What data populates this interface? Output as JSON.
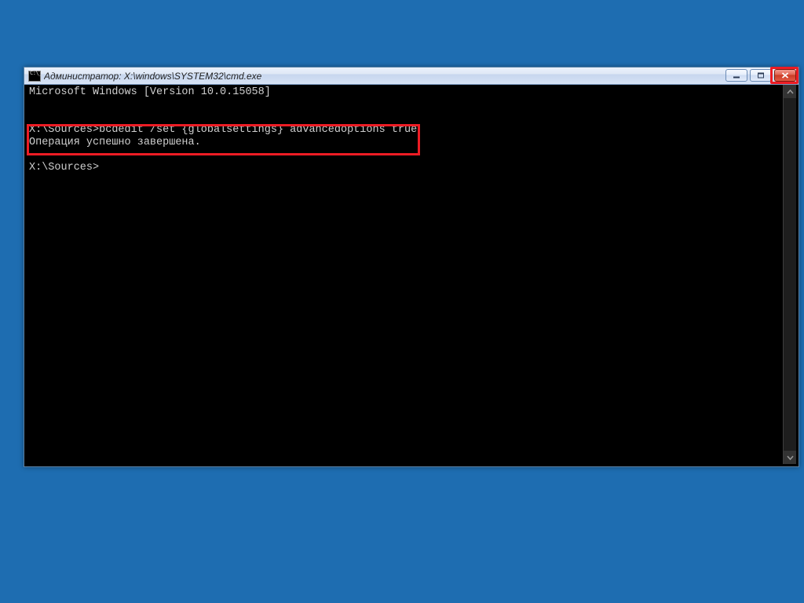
{
  "window": {
    "title": "Администратор: X:\\windows\\SYSTEM32\\cmd.exe"
  },
  "console": {
    "line1": "Microsoft Windows [Version 10.0.15058]",
    "blank1": "",
    "line2": "X:\\Sources>bcdedit /set {globalsettings} advancedoptions true",
    "line3": "Операция успешно завершена.",
    "blank2": "",
    "line4": "X:\\Sources>"
  },
  "icons": {
    "minimize": "minimize",
    "maximize": "maximize",
    "close": "close",
    "scroll_up": "▲",
    "scroll_down": "▼"
  }
}
